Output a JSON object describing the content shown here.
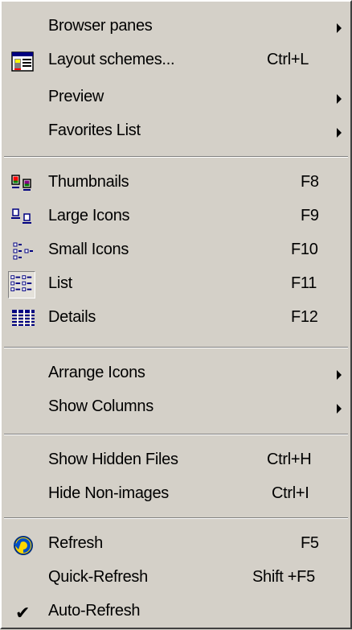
{
  "menu": {
    "items": [
      {
        "label": "Browser panes",
        "shortcut": "",
        "submenu": true
      },
      {
        "label": "Layout schemes...",
        "shortcut": "Ctrl+L",
        "icon": "layout-icon"
      },
      {
        "label": "Preview",
        "shortcut": "",
        "submenu": true
      },
      {
        "label": "Favorites List",
        "shortcut": "",
        "submenu": true
      },
      {
        "label": "Thumbnails",
        "shortcut": "F8",
        "icon": "thumbnails-icon"
      },
      {
        "label": "Large Icons",
        "shortcut": "F9",
        "icon": "large-icons-icon"
      },
      {
        "label": "Small Icons",
        "shortcut": "F10",
        "icon": "small-icons-icon"
      },
      {
        "label": "List",
        "shortcut": "F11",
        "icon": "list-icon",
        "selected": true
      },
      {
        "label": "Details",
        "shortcut": "F12",
        "icon": "details-icon"
      },
      {
        "label": "Arrange Icons",
        "shortcut": "",
        "submenu": true
      },
      {
        "label": "Show Columns",
        "shortcut": "",
        "submenu": true
      },
      {
        "label": "Show Hidden Files",
        "shortcut": "Ctrl+H"
      },
      {
        "label": "Hide Non-images",
        "shortcut": "Ctrl+I"
      },
      {
        "label": "Refresh",
        "shortcut": "F5",
        "icon": "refresh-icon"
      },
      {
        "label": "Quick-Refresh",
        "shortcut": "Shift +F5"
      },
      {
        "label": "Auto-Refresh",
        "shortcut": "",
        "checked": true
      }
    ]
  },
  "colors": {
    "menu_bg": "#d4d0c8",
    "text": "#000000",
    "highlight": "#d4d0c8"
  }
}
